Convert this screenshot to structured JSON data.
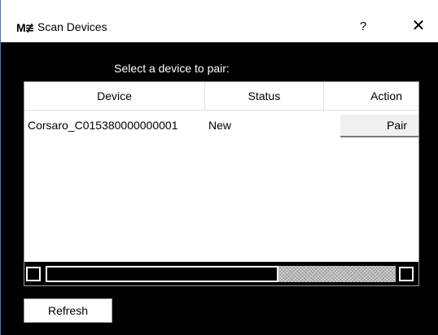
{
  "window": {
    "logo": "M≇",
    "title": "Scan Devices",
    "help_label": "?",
    "close_label": "✕"
  },
  "prompt": "Select a device to pair:",
  "table": {
    "columns": [
      "Device",
      "Status",
      "Action"
    ],
    "rows": [
      {
        "device": "Corsaro_C015380000000001",
        "status": "New",
        "action": "Pair"
      }
    ]
  },
  "refresh_label": "Refresh"
}
